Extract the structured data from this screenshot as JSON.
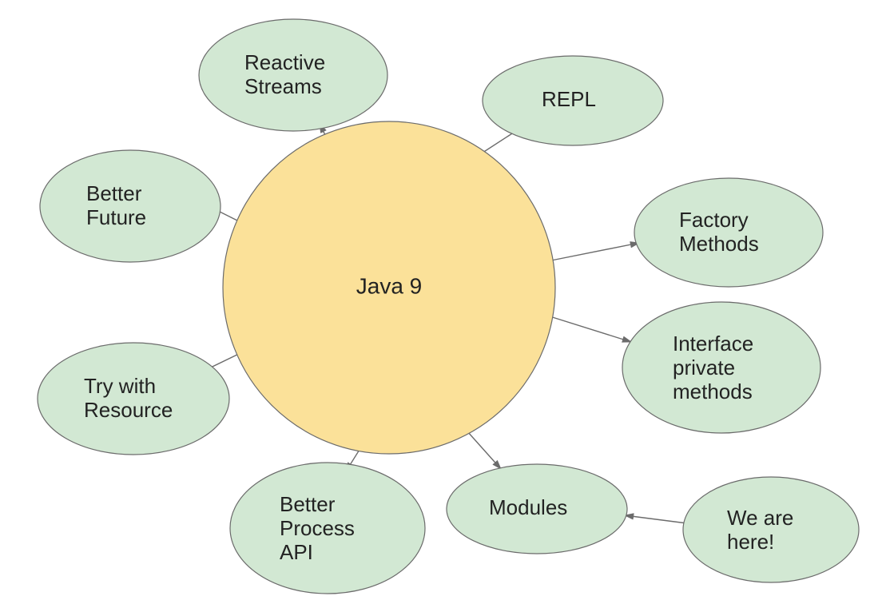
{
  "center": {
    "label": "Java 9"
  },
  "features": [
    {
      "key": "reactive_streams",
      "line1": "Reactive",
      "line2": "Streams"
    },
    {
      "key": "repl",
      "line1": "REPL"
    },
    {
      "key": "better_future",
      "line1": "Better",
      "line2": "Future"
    },
    {
      "key": "factory_methods",
      "line1": "Factory",
      "line2": "Methods"
    },
    {
      "key": "interface_private_methods",
      "line1": "Interface",
      "line2": "private",
      "line3": "methods"
    },
    {
      "key": "try_with_resource",
      "line1": "Try with",
      "line2": "Resource"
    },
    {
      "key": "better_process_api",
      "line1": "Better",
      "line2": "Process",
      "line3": "API"
    },
    {
      "key": "modules",
      "line1": "Modules"
    }
  ],
  "callout": {
    "key": "we_are_here",
    "line1": "We are",
    "line2": "here!"
  }
}
